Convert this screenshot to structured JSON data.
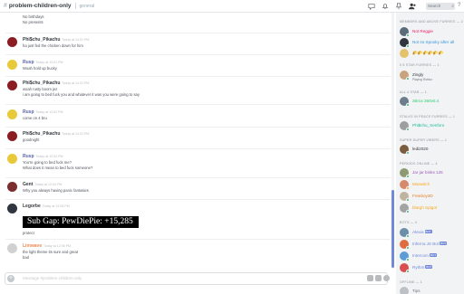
{
  "channel": {
    "name": "problem-children-only",
    "topic": "general"
  },
  "header": {
    "search_placeholder": "Search",
    "help_label": "?"
  },
  "messages": [
    {
      "lines": [
        "No birthdays",
        "No presents"
      ]
    },
    {
      "author": "Phi$chu_Pikachu",
      "timestamp": "Today at 12:01 PM",
      "color": "#36393f",
      "lines": [
        "ha just fed the chicken down for him"
      ]
    },
    {
      "author": "Rusp",
      "timestamp": "Today at 12:01 PM",
      "color": "#5865a7",
      "lines": [
        "Woah hold up bucky"
      ]
    },
    {
      "author": "Phi$chu_Pikachu",
      "timestamp": "Today at 12:02 PM",
      "color": "#36393f",
      "lines": [
        "woah rusty boom jez",
        "i am going to bed fuck you and whatever it was you were going to say"
      ]
    },
    {
      "author": "Rusp",
      "timestamp": "Today at 12:02 PM",
      "color": "#5865a7",
      "lines": [
        "come on 4 bru"
      ]
    },
    {
      "author": "Phi$chu_Pikachu",
      "timestamp": "Today at 12:02 PM",
      "color": "#36393f",
      "lines": [
        "goodnight"
      ]
    },
    {
      "author": "Rusp",
      "timestamp": "Today at 12:03 PM",
      "color": "#5865a7",
      "lines": [
        "You're going to bed fuck me?",
        "What does it mean to bed fuck someone?"
      ]
    },
    {
      "author": "Gent",
      "timestamp": "Today at 12:04 PM",
      "color": "#36393f",
      "lines": [
        "Why you always having panic fantasies"
      ]
    },
    {
      "author": "Legorbe",
      "timestamp": "Today at 12:05 PM",
      "color": "#36393f",
      "embed": "Sub Gap: PewDiePie: +15,285",
      "lines": [
        "protect"
      ]
    },
    {
      "author": "Limwave",
      "timestamp": "Today at 12:06 PM",
      "color": "#ed8a52",
      "lines": [
        "the light theme its sure and great",
        "bad"
      ]
    }
  ],
  "composer": {
    "placeholder": "Message #problem-children-only"
  },
  "roles": [
    {
      "label": "MEMBERS AND ABOVE FURRIES — 2"
    },
    {
      "label": "5 5 STAR FURRIES — 1"
    },
    {
      "label": "ALL 4 STAR — 1"
    },
    {
      "label": "STALKS IN PEACE FURRIES — 1"
    },
    {
      "label": "SUPER DUPER VIBERS — 1"
    },
    {
      "label": "PERIODS ONLINE — 4"
    },
    {
      "label": "BOTS — 4"
    },
    {
      "label": "OFFLINE — 1"
    }
  ],
  "members": [
    {
      "name": "Not Reggie",
      "color": "#e91e63",
      "avatar": "#5b6b7b"
    },
    {
      "name": "Not so Spooky after all",
      "color": "#3498db",
      "avatar": "#2f3640"
    },
    {
      "name": "",
      "color": "#f1c40f",
      "avatar": "#e2c36b"
    },
    {
      "name": "Zingly",
      "status": "Playing Roblox",
      "color": "#36393f",
      "avatar": "#c9a27e"
    },
    {
      "name": "zBrox 360v5.4",
      "color": "#2ecc71",
      "avatar": "#6d7d8d"
    },
    {
      "name": "Phi$chu_Xenforo",
      "color": "#1abc9c",
      "avatar": "#9e9e9e"
    },
    {
      "name": "ledi2020",
      "color": "#36393f",
      "avatar": "#7a5c3e"
    },
    {
      "name": "Jar jar binks 125",
      "color": "#9b59b6",
      "avatar": "#8e9a70"
    },
    {
      "name": "Maxwitch",
      "color": "#faa61a",
      "avatar": "#d58a6e"
    },
    {
      "name": "Freeboy3D",
      "color": "#e67e22",
      "avatar": "#c0b4a0"
    },
    {
      "name": "blargh Spigot",
      "color": "#faa61a",
      "avatar": "#a3a3a3"
    },
    {
      "name": "Alexia",
      "color": "#7289da",
      "avatar": "#6b8fa6",
      "bot": "BOT"
    },
    {
      "name": "Inferno.JS Bot",
      "color": "#7289da",
      "avatar": "#e06b3f",
      "bot": "BOT"
    },
    {
      "name": "Intercom",
      "color": "#7289da",
      "avatar": "#5b9cd6",
      "bot": "BOT"
    },
    {
      "name": "Rythm",
      "color": "#7289da",
      "avatar": "#d94f4f",
      "bot": "BOT"
    },
    {
      "name": "Tips",
      "color": "#72767d",
      "avatar": "#9aa0a6"
    }
  ],
  "colors": {
    "accent": "#7289da",
    "online": "#43b581",
    "idle": "#faa61a"
  }
}
